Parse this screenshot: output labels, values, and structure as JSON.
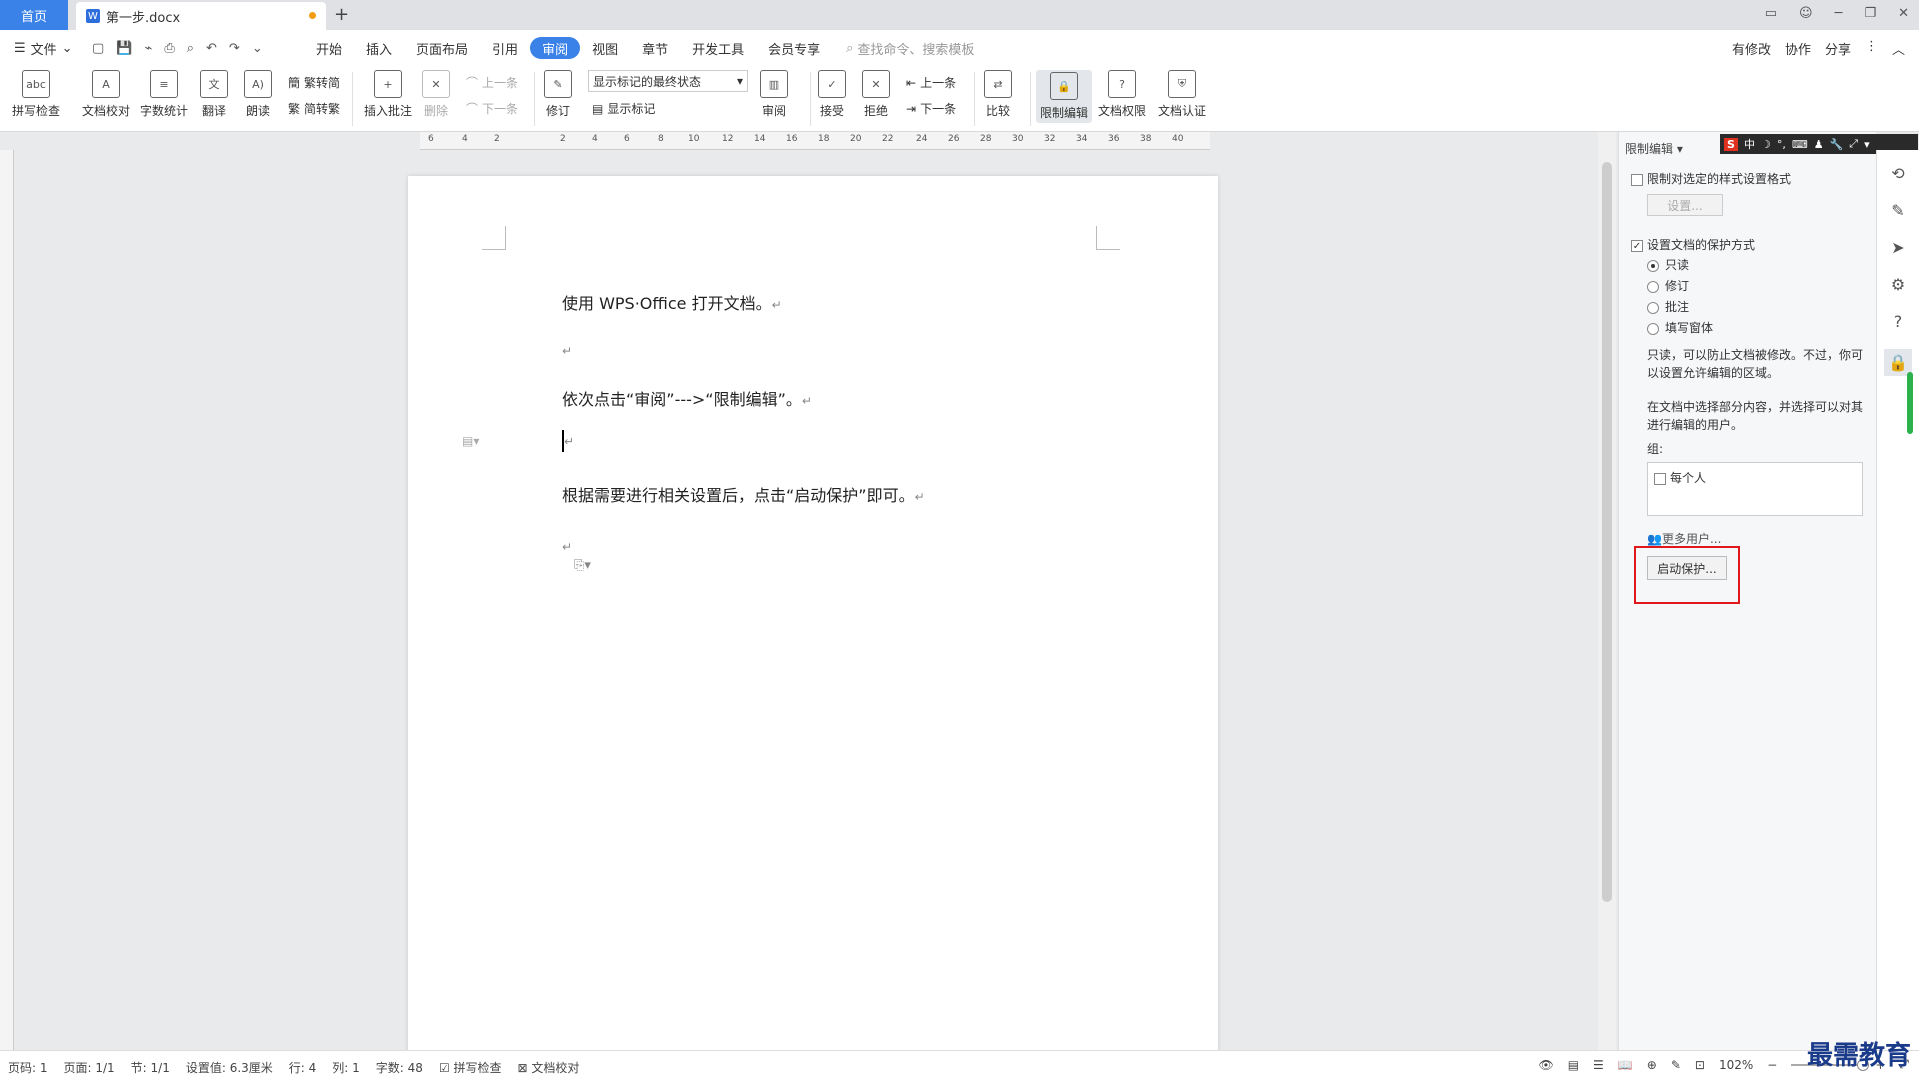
{
  "tabs": {
    "home": "首页",
    "doc": "第一步.docx"
  },
  "menu": {
    "file": "文件",
    "tabs": [
      "开始",
      "插入",
      "页面布局",
      "引用",
      "审阅",
      "视图",
      "章节",
      "开发工具",
      "会员专享"
    ],
    "active_tab": "审阅",
    "search_placeholder": "查找命令、搜索模板",
    "right": [
      "有修改",
      "协作",
      "分享"
    ]
  },
  "ribbon": {
    "spell": "拼写检查",
    "proof": "文档校对",
    "wordcount": "字数统计",
    "translate": "翻译",
    "read": "朗读",
    "t2s": "繁转简",
    "s2t": "简转繁",
    "insert_comment": "插入批注",
    "delete": "删除",
    "prev1": "上一条",
    "next1": "下一条",
    "track": "修订",
    "display_mode": "显示标记的最终状态",
    "show_markup": "显示标记",
    "review": "审阅",
    "accept": "接受",
    "reject": "拒绝",
    "prev2": "上一条",
    "next2": "下一条",
    "compare": "比较",
    "restrict": "限制编辑",
    "permission": "文档权限",
    "certify": "文档认证"
  },
  "ruler": [
    "6",
    "4",
    "2",
    "2",
    "4",
    "6",
    "8",
    "10",
    "12",
    "14",
    "16",
    "18",
    "20",
    "22",
    "24",
    "26",
    "28",
    "30",
    "32",
    "34",
    "36",
    "38",
    "40"
  ],
  "document": {
    "lines": [
      "使用 WPS·Office 打开文档。",
      "依次点击“审阅”--->“限制编辑”。",
      "根据需要进行相关设置后，点击“启动保护”即可。"
    ],
    "return_mark": "↵"
  },
  "panel": {
    "title": "限制编辑",
    "restrict_format": "限制对选定的样式设置格式",
    "settings_btn": "设置...",
    "protect_mode": "设置文档的保护方式",
    "options": [
      "只读",
      "修订",
      "批注",
      "填写窗体"
    ],
    "selected_option": "只读",
    "desc1": "只读，可以防止文档被修改。不过，你可以设置允许编辑的区域。",
    "desc2": "在文档中选择部分内容，并选择可以对其进行编辑的用户。",
    "group_label": "组:",
    "everyone": "每个人",
    "more_users": "更多用户...",
    "start_btn": "启动保护..."
  },
  "ime": {
    "s": "S",
    "items": [
      "中",
      "☽",
      "°,",
      "⌨",
      "♟",
      "🔧",
      "⤢",
      "▾"
    ]
  },
  "status": {
    "page_code": "页码: 1",
    "page": "页面: 1/1",
    "section": "节: 1/1",
    "setting": "设置值: 6.3厘米",
    "row": "行: 4",
    "col": "列: 1",
    "words": "字数: 48",
    "spell": "拼写检查",
    "proof": "文档校对",
    "zoom": "102%"
  },
  "watermark": "最需教育"
}
